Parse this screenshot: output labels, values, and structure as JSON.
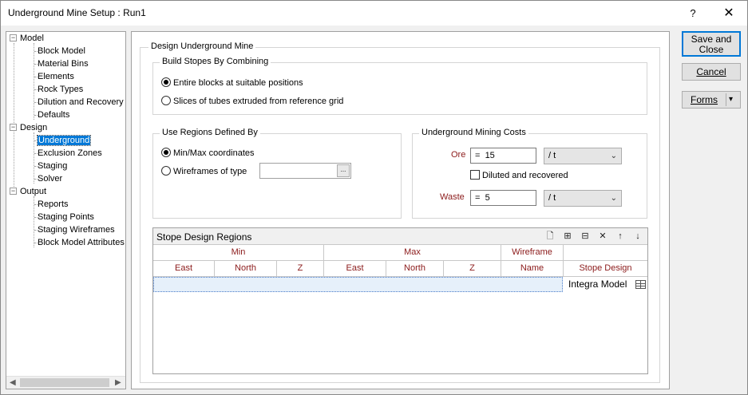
{
  "window": {
    "title": "Underground  Mine Setup : Run1",
    "help_glyph": "?",
    "close_glyph": "✕"
  },
  "tree": {
    "expander_glyph": "−",
    "groups": [
      {
        "label": "Model",
        "children": [
          "Block Model",
          "Material Bins",
          "Elements",
          "Rock Types",
          "Dilution and Recovery",
          "Defaults"
        ]
      },
      {
        "label": "Design",
        "children": [
          "Underground",
          "Exclusion Zones",
          "Staging",
          "Solver"
        ]
      },
      {
        "label": "Output",
        "children": [
          "Reports",
          "Staging Points",
          "Staging Wireframes",
          "Block Model Attributes"
        ]
      }
    ],
    "selected": "Underground"
  },
  "design": {
    "group_label": "Design Underground Mine",
    "build_stopes": {
      "label": "Build Stopes By Combining",
      "option_entire": "Entire blocks at suitable positions",
      "option_slices": "Slices of tubes extruded from reference grid",
      "selected": "entire"
    },
    "regions": {
      "label": "Use Regions Defined By",
      "option_minmax": "Min/Max coordinates",
      "option_wireframes": "Wireframes of type",
      "selected": "minmax",
      "wireframe_type_value": "",
      "browse_glyph": "..."
    },
    "costs": {
      "label": "Underground Mining Costs",
      "ore_label": "Ore",
      "ore_eq": "=",
      "ore_value": "15",
      "ore_unit": "/ t",
      "diluted_label": "Diluted and recovered",
      "diluted_checked": false,
      "waste_label": "Waste",
      "waste_eq": "=",
      "waste_value": "5",
      "waste_unit": "/ t"
    },
    "stope_regions": {
      "title": "Stope Design Regions",
      "group_headers": {
        "min": "Min",
        "max": "Max",
        "wireframe": "Wireframe"
      },
      "columns": {
        "min_east": "East",
        "min_north": "North",
        "min_z": "Z",
        "max_east": "East",
        "max_north": "North",
        "max_z": "Z",
        "name": "Name",
        "stope_design": "Stope Design"
      },
      "row_stope_design": "Integra Model",
      "tools": {
        "new": "🗋",
        "insert": "⊞",
        "insert_after": "⊟",
        "delete": "✕",
        "move_up": "↑",
        "move_down": "↓"
      }
    }
  },
  "buttons": {
    "save_close": "Save and Close",
    "cancel": "Cancel",
    "forms": "Forms",
    "forms_chevron": "▾"
  }
}
